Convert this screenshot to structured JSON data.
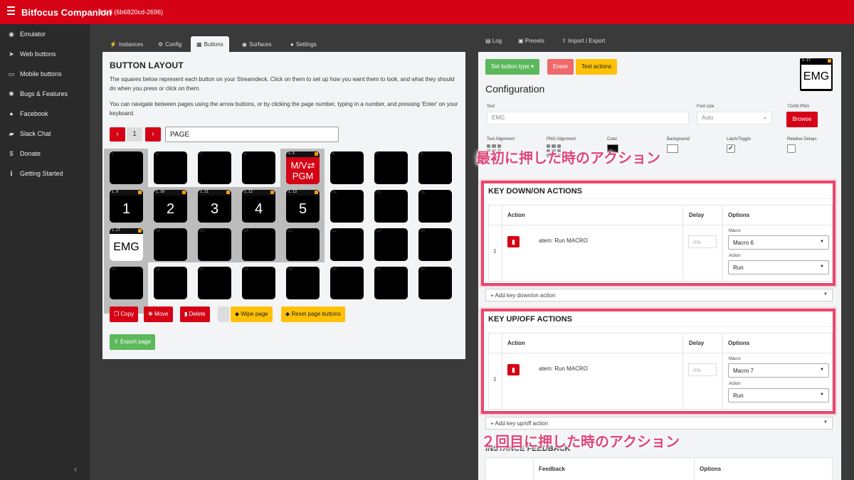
{
  "app": {
    "name": "Bitfocus Companion",
    "version": "2.1.3 (6b6820cd-2696)"
  },
  "sidebar": {
    "items": [
      {
        "label": "Emulator",
        "icon": "gamepad-icon"
      },
      {
        "label": "Web buttons",
        "icon": "pointer-icon"
      },
      {
        "label": "Mobile buttons",
        "icon": "tablet-icon"
      },
      {
        "label": "Bugs & Features",
        "icon": "bug-icon"
      },
      {
        "label": "Facebook",
        "icon": "users-icon"
      },
      {
        "label": "Slack Chat",
        "icon": "comments-icon"
      },
      {
        "label": "Donate",
        "icon": "dollar-icon"
      },
      {
        "label": "Getting Started",
        "icon": "info-icon"
      }
    ]
  },
  "left_tabs": [
    "Instances",
    "Config",
    "Buttons",
    "Surfaces",
    "Settings"
  ],
  "right_tabs": [
    "Log",
    "Presets",
    "Import / Export"
  ],
  "layout": {
    "title": "BUTTON LAYOUT",
    "p1": "The squares below represent each button on your Streamdeck. Click on them to set up how you want them to look, and what they should do when you press or click on them.",
    "p2": "You can navigate between pages using the arrow buttons, or by clicking the page number, typing in a number, and pressing 'Enter' on your keyboard.",
    "page_number": "1",
    "page_name": "PAGE",
    "buttons": {
      "b1_5": {
        "num": "1.5",
        "line1": "M/V⇄",
        "line2": "PGM"
      },
      "b1_9": {
        "num": "1.9",
        "text": "1"
      },
      "b1_10": {
        "num": "1.10",
        "text": "2"
      },
      "b1_11": {
        "num": "1.11",
        "text": "3"
      },
      "b1_12": {
        "num": "1.12",
        "text": "4"
      },
      "b1_13": {
        "num": "1.13",
        "text": "5"
      },
      "b1_17": {
        "num": "1.17",
        "text": "EMG"
      }
    },
    "actions": {
      "copy": "Copy",
      "move": "Move",
      "delete": "Delete",
      "wipe": "Wipe page",
      "reset": "Reset page buttons",
      "export": "Export page"
    }
  },
  "config": {
    "set_type": "Set button type",
    "erase": "Erase",
    "test": "Test actions",
    "preview_num": "1.17",
    "preview_text": "EMG",
    "title": "Configuration",
    "text_label": "Text",
    "text_value": "EMG",
    "font_size_label": "Font size",
    "font_size_value": "Auto",
    "png_label": "72x58 PNG",
    "browse": "Browse",
    "text_align_label": "Text Alignment",
    "png_align_label": "PNG Alignment",
    "color_label": "Color",
    "bg_label": "Background",
    "latch_label": "Latch/Toggle",
    "relative_label": "Relative Delays"
  },
  "down": {
    "title": "KEY DOWN/ON ACTIONS",
    "col_action": "Action",
    "col_delay": "Delay",
    "col_options": "Options",
    "action": "atem: Run MACRO",
    "delay_placeholder": "ms",
    "macro_label": "Macro",
    "macro_value": "Macro 6",
    "act_label": "Action",
    "act_value": "Run",
    "add": "+ Add key down/on action"
  },
  "up": {
    "title": "KEY UP/OFF ACTIONS",
    "col_action": "Action",
    "col_delay": "Delay",
    "col_options": "Options",
    "action": "atem: Run MACRO",
    "delay_placeholder": "ms",
    "macro_label": "Macro",
    "macro_value": "Macro 7",
    "act_label": "Action",
    "act_value": "Run",
    "add": "+ Add key up/off action"
  },
  "feedback": {
    "title": "INSTANCE FEEDBACK",
    "col_feedback": "Feedback",
    "col_options": "Options"
  },
  "annotations": {
    "first": "最初に押した時のアクション",
    "second": "２回目に押した時のアクション"
  },
  "colors": {
    "brand": "#d50215",
    "accent_yellow": "#ffc107",
    "green": "#5cb85c",
    "annotation": "#e0467a"
  }
}
